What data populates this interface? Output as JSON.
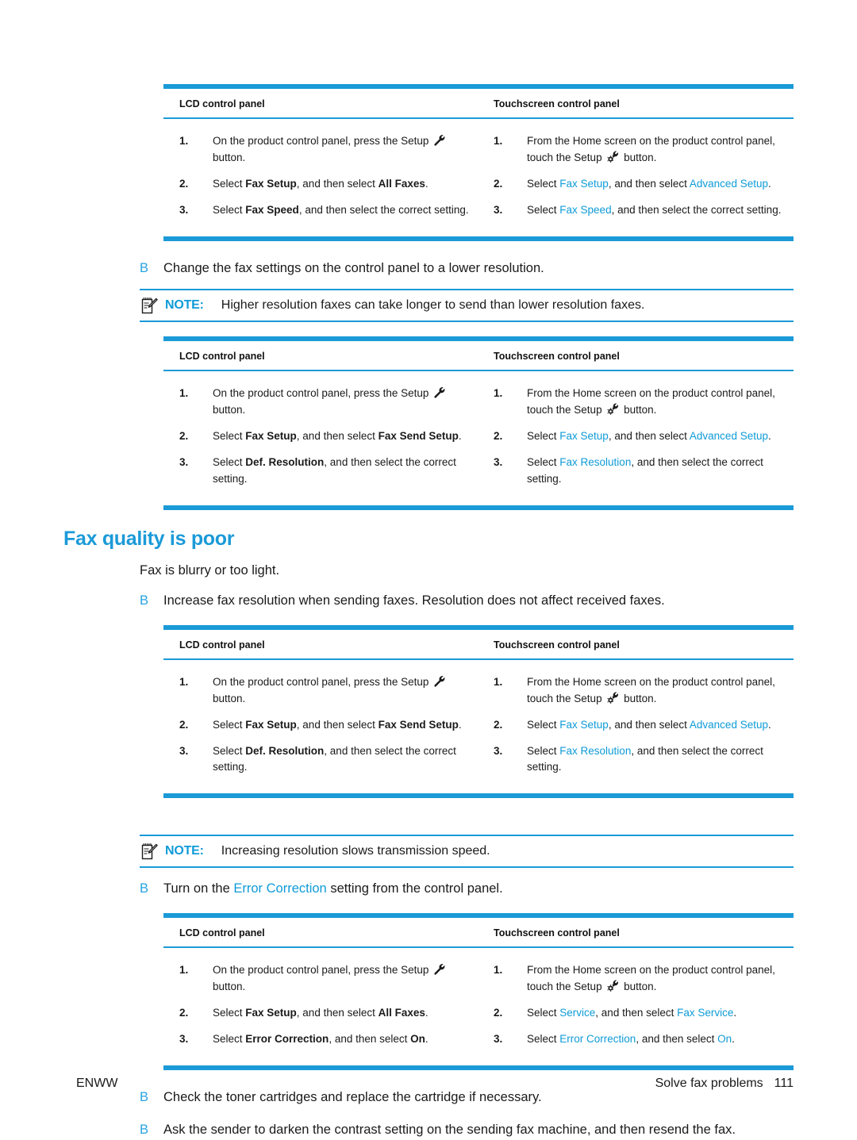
{
  "page": {
    "footer_left": "ENWW",
    "footer_right_label": "Solve fax problems",
    "footer_page_number": "111",
    "accent_color": "#1b9ad8",
    "link_color": "#29a3e0"
  },
  "table_headers": {
    "lcd": "LCD control panel",
    "touchscreen": "Touchscreen control panel"
  },
  "tables": [
    {
      "id": "fax-speed-table",
      "lcd_steps": [
        {
          "parts": [
            {
              "t": "On the product control panel, press the Setup ",
              "s": "plain"
            },
            {
              "t": "wrench-icon",
              "s": "icon-wrench"
            },
            {
              "t": " button.",
              "s": "plain"
            }
          ]
        },
        {
          "parts": [
            {
              "t": "Select ",
              "s": "plain"
            },
            {
              "t": "Fax Setup",
              "s": "bold"
            },
            {
              "t": ", and then select ",
              "s": "plain"
            },
            {
              "t": "All Faxes",
              "s": "bold"
            },
            {
              "t": ".",
              "s": "plain"
            }
          ]
        },
        {
          "parts": [
            {
              "t": "Select ",
              "s": "plain"
            },
            {
              "t": "Fax Speed",
              "s": "bold"
            },
            {
              "t": ", and then select the correct setting.",
              "s": "plain"
            }
          ]
        }
      ],
      "touch_steps": [
        {
          "parts": [
            {
              "t": "From the Home screen on the product control panel, touch the Setup ",
              "s": "plain"
            },
            {
              "t": "wrench-gear-icon",
              "s": "icon-wrench-gear"
            },
            {
              "t": " button.",
              "s": "plain"
            }
          ]
        },
        {
          "parts": [
            {
              "t": "Select ",
              "s": "plain"
            },
            {
              "t": "Fax Setup",
              "s": "blue"
            },
            {
              "t": ", and then select ",
              "s": "plain"
            },
            {
              "t": "Advanced Setup",
              "s": "blue"
            },
            {
              "t": ".",
              "s": "plain"
            }
          ]
        },
        {
          "parts": [
            {
              "t": "Select ",
              "s": "plain"
            },
            {
              "t": "Fax Speed",
              "s": "blue"
            },
            {
              "t": ", and then select the correct setting.",
              "s": "plain"
            }
          ]
        }
      ]
    },
    {
      "id": "def-resolution-table-1",
      "lcd_steps": [
        {
          "parts": [
            {
              "t": "On the product control panel, press the Setup ",
              "s": "plain"
            },
            {
              "t": "wrench-icon",
              "s": "icon-wrench"
            },
            {
              "t": " button.",
              "s": "plain"
            }
          ]
        },
        {
          "parts": [
            {
              "t": "Select ",
              "s": "plain"
            },
            {
              "t": "Fax Setup",
              "s": "bold"
            },
            {
              "t": ", and then select ",
              "s": "plain"
            },
            {
              "t": "Fax Send Setup",
              "s": "bold"
            },
            {
              "t": ".",
              "s": "plain"
            }
          ]
        },
        {
          "parts": [
            {
              "t": "Select ",
              "s": "plain"
            },
            {
              "t": "Def. Resolution",
              "s": "bold"
            },
            {
              "t": ", and then select the correct setting.",
              "s": "plain"
            }
          ]
        }
      ],
      "touch_steps": [
        {
          "parts": [
            {
              "t": "From the Home screen on the product control panel, touch the Setup ",
              "s": "plain"
            },
            {
              "t": "wrench-gear-icon",
              "s": "icon-wrench-gear"
            },
            {
              "t": " button.",
              "s": "plain"
            }
          ]
        },
        {
          "parts": [
            {
              "t": "Select ",
              "s": "plain"
            },
            {
              "t": "Fax Setup",
              "s": "blue"
            },
            {
              "t": ", and then select ",
              "s": "plain"
            },
            {
              "t": "Advanced Setup",
              "s": "blue"
            },
            {
              "t": ".",
              "s": "plain"
            }
          ]
        },
        {
          "parts": [
            {
              "t": "Select ",
              "s": "plain"
            },
            {
              "t": "Fax Resolution",
              "s": "blue"
            },
            {
              "t": ", and then select the correct setting.",
              "s": "plain"
            }
          ]
        }
      ]
    },
    {
      "id": "def-resolution-table-2",
      "lcd_steps": [
        {
          "parts": [
            {
              "t": "On the product control panel, press the Setup ",
              "s": "plain"
            },
            {
              "t": "wrench-icon",
              "s": "icon-wrench"
            },
            {
              "t": " button.",
              "s": "plain"
            }
          ]
        },
        {
          "parts": [
            {
              "t": "Select ",
              "s": "plain"
            },
            {
              "t": "Fax Setup",
              "s": "bold"
            },
            {
              "t": ", and then select ",
              "s": "plain"
            },
            {
              "t": "Fax Send Setup",
              "s": "bold"
            },
            {
              "t": ".",
              "s": "plain"
            }
          ]
        },
        {
          "parts": [
            {
              "t": "Select ",
              "s": "plain"
            },
            {
              "t": "Def. Resolution",
              "s": "bold"
            },
            {
              "t": ", and then select the correct setting.",
              "s": "plain"
            }
          ]
        }
      ],
      "touch_steps": [
        {
          "parts": [
            {
              "t": "From the Home screen on the product control panel, touch the Setup ",
              "s": "plain"
            },
            {
              "t": "wrench-gear-icon",
              "s": "icon-wrench-gear"
            },
            {
              "t": " button.",
              "s": "plain"
            }
          ]
        },
        {
          "parts": [
            {
              "t": "Select ",
              "s": "plain"
            },
            {
              "t": "Fax Setup",
              "s": "blue"
            },
            {
              "t": ", and then select ",
              "s": "plain"
            },
            {
              "t": "Advanced Setup",
              "s": "blue"
            },
            {
              "t": ".",
              "s": "plain"
            }
          ]
        },
        {
          "parts": [
            {
              "t": "Select ",
              "s": "plain"
            },
            {
              "t": "Fax Resolution",
              "s": "blue"
            },
            {
              "t": ", and then select the correct setting.",
              "s": "plain"
            }
          ]
        }
      ]
    },
    {
      "id": "error-correction-table",
      "lcd_steps": [
        {
          "parts": [
            {
              "t": "On the product control panel, press the Setup ",
              "s": "plain"
            },
            {
              "t": "wrench-icon",
              "s": "icon-wrench"
            },
            {
              "t": " button.",
              "s": "plain"
            }
          ]
        },
        {
          "parts": [
            {
              "t": "Select ",
              "s": "plain"
            },
            {
              "t": "Fax Setup",
              "s": "bold"
            },
            {
              "t": ", and then select ",
              "s": "plain"
            },
            {
              "t": "All Faxes",
              "s": "bold"
            },
            {
              "t": ".",
              "s": "plain"
            }
          ]
        },
        {
          "parts": [
            {
              "t": "Select ",
              "s": "plain"
            },
            {
              "t": "Error Correction",
              "s": "bold"
            },
            {
              "t": ", and then select ",
              "s": "plain"
            },
            {
              "t": "On",
              "s": "bold"
            },
            {
              "t": ".",
              "s": "plain"
            }
          ]
        }
      ],
      "touch_steps": [
        {
          "parts": [
            {
              "t": "From the Home screen on the product control panel, touch the Setup ",
              "s": "plain"
            },
            {
              "t": "wrench-gear-icon",
              "s": "icon-wrench-gear"
            },
            {
              "t": " button.",
              "s": "plain"
            }
          ]
        },
        {
          "parts": [
            {
              "t": "Select ",
              "s": "plain"
            },
            {
              "t": "Service",
              "s": "blue"
            },
            {
              "t": ", and then select ",
              "s": "plain"
            },
            {
              "t": "Fax Service",
              "s": "blue"
            },
            {
              "t": ".",
              "s": "plain"
            }
          ]
        },
        {
          "parts": [
            {
              "t": "Select ",
              "s": "plain"
            },
            {
              "t": "Error Correction",
              "s": "blue"
            },
            {
              "t": ", and then select ",
              "s": "plain"
            },
            {
              "t": "On",
              "s": "blue"
            },
            {
              "t": ".",
              "s": "plain"
            }
          ]
        }
      ]
    }
  ],
  "bullets": {
    "change_fax_settings": {
      "marker": "B",
      "parts": [
        {
          "t": "Change the fax settings on the control panel to a lower resolution.",
          "s": "plain"
        }
      ]
    },
    "increase_resolution": {
      "marker": "B",
      "parts": [
        {
          "t": "Increase fax resolution when sending faxes. Resolution does not affect received faxes.",
          "s": "plain"
        }
      ]
    },
    "error_correction": {
      "marker": "B",
      "parts": [
        {
          "t": "Turn on the ",
          "s": "plain"
        },
        {
          "t": "Error Correction",
          "s": "blue"
        },
        {
          "t": " setting from the control panel.",
          "s": "plain"
        }
      ]
    },
    "toner_cartridges": {
      "marker": "B",
      "parts": [
        {
          "t": "Check the toner cartridges and replace the cartridge if necessary.",
          "s": "plain"
        }
      ]
    },
    "darken_contrast": {
      "marker": "B",
      "parts": [
        {
          "t": "Ask the sender to darken the contrast setting on the sending fax machine, and then resend the fax.",
          "s": "plain"
        }
      ]
    }
  },
  "notes": {
    "higher_resolution": {
      "label": "NOTE:",
      "text": "Higher resolution faxes can take longer to send than lower resolution faxes."
    },
    "slows_transmission": {
      "label": "NOTE:",
      "text": "Increasing resolution slows transmission speed."
    }
  },
  "headings": {
    "fax_quality": "Fax quality is poor"
  },
  "body": {
    "fax_blurry": "Fax is blurry or too light."
  }
}
